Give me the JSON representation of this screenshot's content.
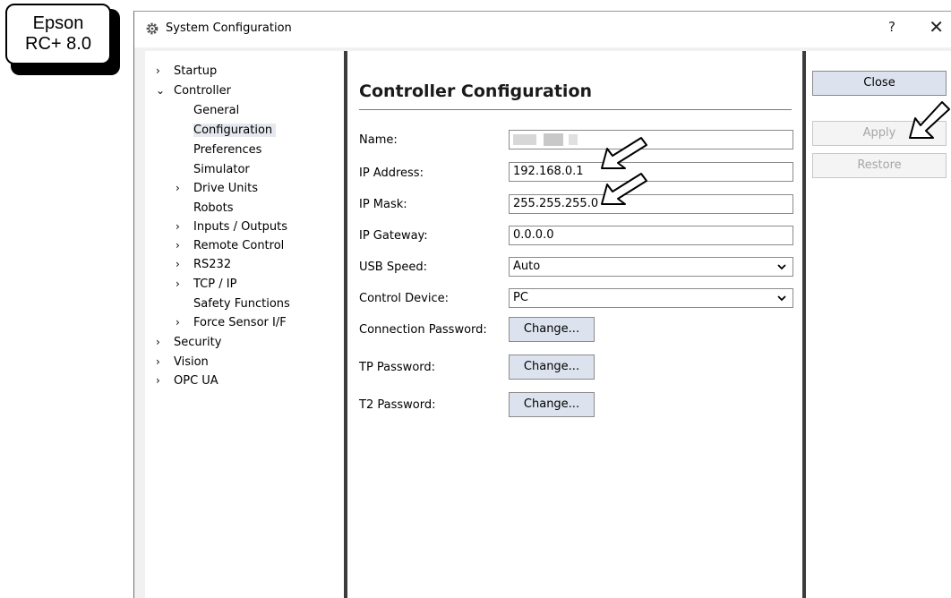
{
  "badge": {
    "line1": "Epson",
    "line2": "RC+ 8.0"
  },
  "window": {
    "title": "System Configuration",
    "help": "?",
    "close": "✕"
  },
  "tree": {
    "items": [
      {
        "label": "Startup",
        "chevron": "›"
      },
      {
        "label": "Controller",
        "chevron": "⌄"
      },
      {
        "label": "General",
        "chevron": ""
      },
      {
        "label": "Configuration",
        "chevron": ""
      },
      {
        "label": "Preferences",
        "chevron": ""
      },
      {
        "label": "Simulator",
        "chevron": ""
      },
      {
        "label": "Drive Units",
        "chevron": "›"
      },
      {
        "label": "Robots",
        "chevron": ""
      },
      {
        "label": "Inputs / Outputs",
        "chevron": "›"
      },
      {
        "label": "Remote Control",
        "chevron": "›"
      },
      {
        "label": "RS232",
        "chevron": "›"
      },
      {
        "label": "TCP / IP",
        "chevron": "›"
      },
      {
        "label": "Safety Functions",
        "chevron": ""
      },
      {
        "label": "Force Sensor I/F",
        "chevron": "›"
      },
      {
        "label": "Security",
        "chevron": "›"
      },
      {
        "label": "Vision",
        "chevron": "›"
      },
      {
        "label": "OPC UA",
        "chevron": "›"
      }
    ],
    "selected": "Configuration"
  },
  "config": {
    "title": "Controller Configuration",
    "name_label": "Name:",
    "ip_address_label": "IP Address:",
    "ip_address_value": "192.168.0.1",
    "ip_mask_label": "IP Mask:",
    "ip_mask_value": "255.255.255.0",
    "ip_gateway_label": "IP Gateway:",
    "ip_gateway_value": "0.0.0.0",
    "usb_speed_label": "USB Speed:",
    "usb_speed_value": "Auto",
    "control_device_label": "Control Device:",
    "control_device_value": "PC",
    "connection_password_label": "Connection Password:",
    "tp_password_label": "TP Password:",
    "t2_password_label": "T2 Password:",
    "change_label": "Change..."
  },
  "buttons": {
    "close": "Close",
    "apply": "Apply",
    "restore": "Restore"
  },
  "icons": {
    "title": "gear-icon",
    "chevron": "chevron-icon",
    "annotation": "arrow-icon"
  }
}
